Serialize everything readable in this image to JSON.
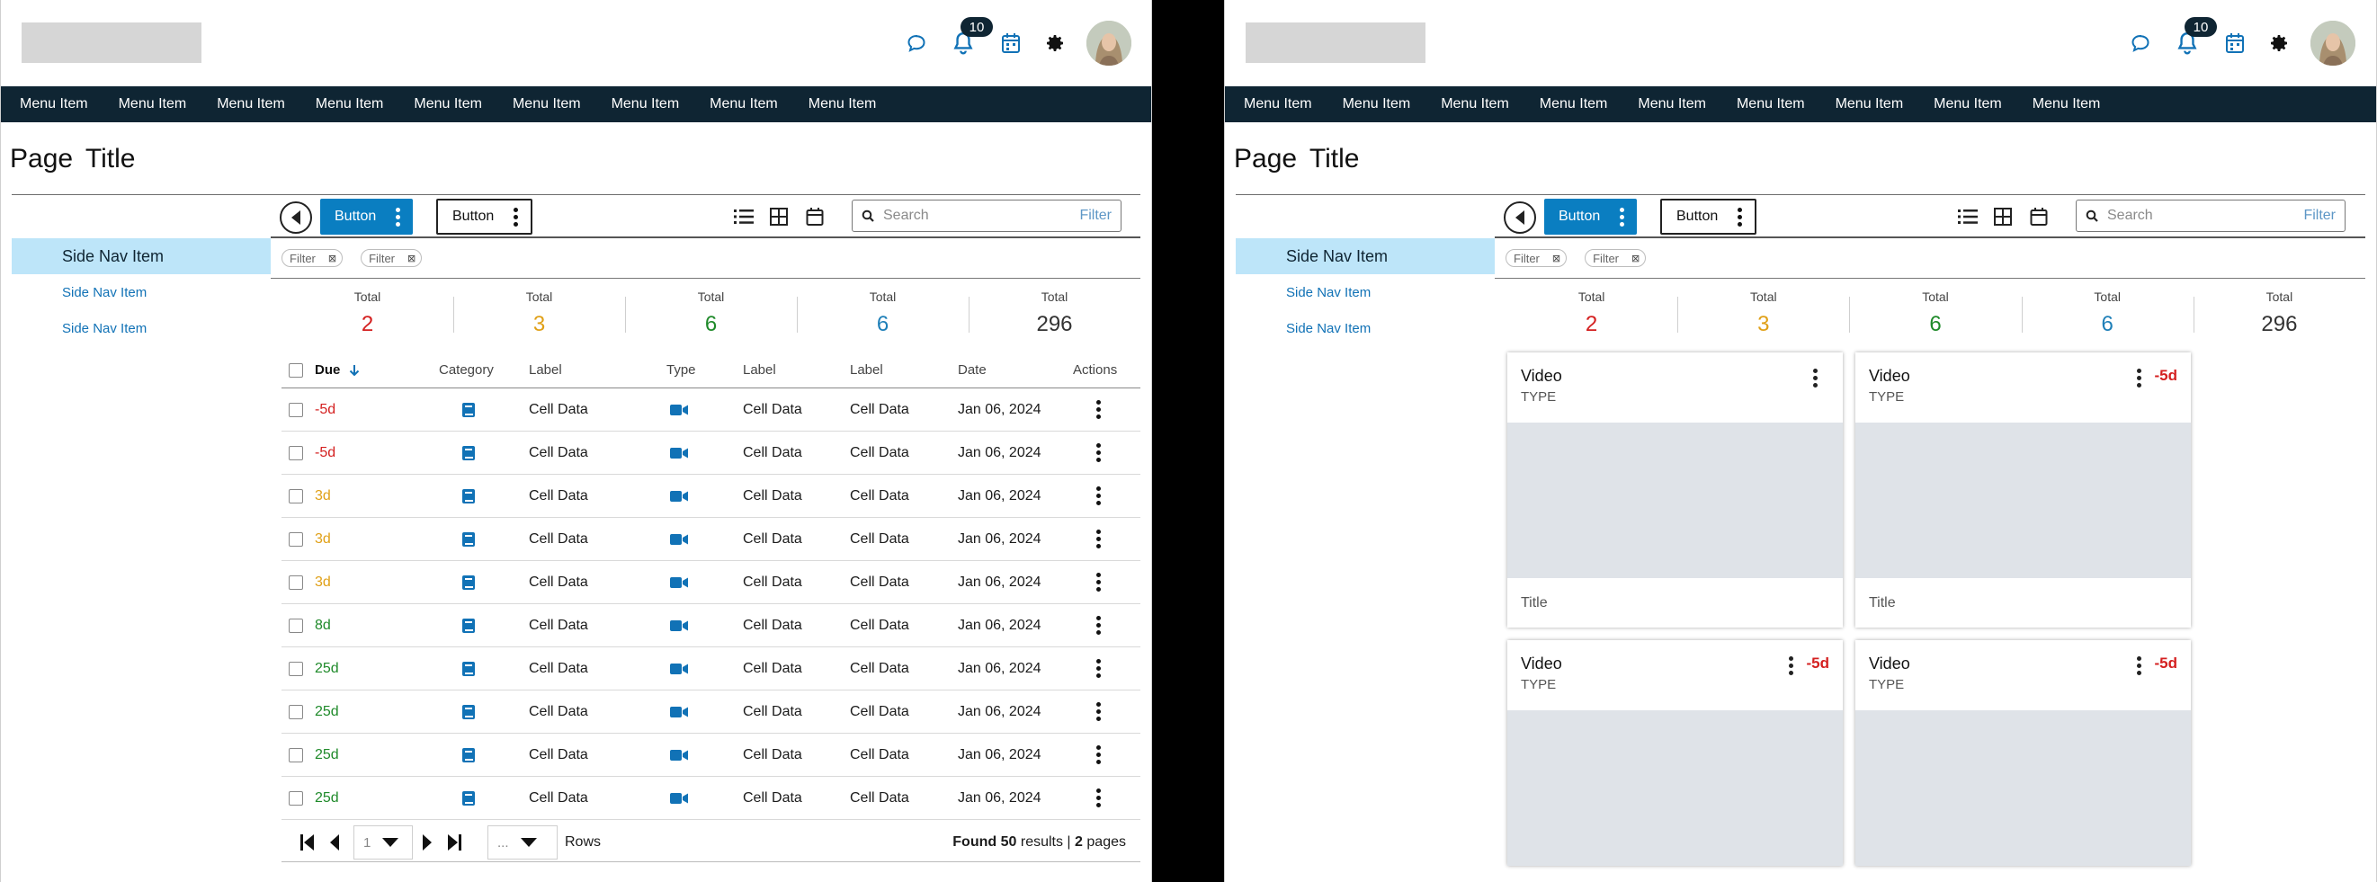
{
  "header": {
    "notification_count": "10",
    "icons": [
      "chat-icon",
      "bell-icon",
      "calendar-icon",
      "gear-icon"
    ]
  },
  "nav": {
    "items": [
      "Menu Item",
      "Menu Item",
      "Menu Item",
      "Menu Item",
      "Menu Item",
      "Menu Item",
      "Menu Item",
      "Menu Item",
      "Menu Item"
    ]
  },
  "page": {
    "title": "Page  Title"
  },
  "toolbar": {
    "button_primary": "Button",
    "button_secondary": "Button",
    "search_placeholder": "Search",
    "filter_label": "Filter"
  },
  "sidenav": {
    "items": [
      "Side Nav Item",
      "Side Nav Item",
      "Side Nav Item"
    ]
  },
  "filters": [
    "Filter",
    "Filter"
  ],
  "totals": [
    {
      "label": "Total",
      "value": "2",
      "color": "#d42020"
    },
    {
      "label": "Total",
      "value": "3",
      "color": "#e0a017"
    },
    {
      "label": "Total",
      "value": "6",
      "color": "#1f8a2a"
    },
    {
      "label": "Total",
      "value": "6",
      "color": "#1e7fb8"
    },
    {
      "label": "Total",
      "value": "296",
      "color": "#333333"
    }
  ],
  "table": {
    "columns": [
      "Due",
      "Category",
      "Label",
      "Type",
      "Label",
      "Label",
      "Date",
      "Actions"
    ],
    "rows": [
      {
        "due": "-5d",
        "status": "neg",
        "c1": "Cell Data",
        "c2": "Cell Data",
        "c3": "Cell Data",
        "date": "Jan 06, 2024"
      },
      {
        "due": "-5d",
        "status": "neg",
        "c1": "Cell Data",
        "c2": "Cell Data",
        "c3": "Cell Data",
        "date": "Jan 06, 2024"
      },
      {
        "due": "3d",
        "status": "mid",
        "c1": "Cell Data",
        "c2": "Cell Data",
        "c3": "Cell Data",
        "date": "Jan 06, 2024"
      },
      {
        "due": "3d",
        "status": "mid",
        "c1": "Cell Data",
        "c2": "Cell Data",
        "c3": "Cell Data",
        "date": "Jan 06, 2024"
      },
      {
        "due": "3d",
        "status": "mid",
        "c1": "Cell Data",
        "c2": "Cell Data",
        "c3": "Cell Data",
        "date": "Jan 06, 2024"
      },
      {
        "due": "8d",
        "status": "pos",
        "c1": "Cell Data",
        "c2": "Cell Data",
        "c3": "Cell Data",
        "date": "Jan 06, 2024"
      },
      {
        "due": "25d",
        "status": "pos",
        "c1": "Cell Data",
        "c2": "Cell Data",
        "c3": "Cell Data",
        "date": "Jan 06, 2024"
      },
      {
        "due": "25d",
        "status": "pos",
        "c1": "Cell Data",
        "c2": "Cell Data",
        "c3": "Cell Data",
        "date": "Jan 06, 2024"
      },
      {
        "due": "25d",
        "status": "pos",
        "c1": "Cell Data",
        "c2": "Cell Data",
        "c3": "Cell Data",
        "date": "Jan 06, 2024"
      },
      {
        "due": "25d",
        "status": "pos",
        "c1": "Cell Data",
        "c2": "Cell Data",
        "c3": "Cell Data",
        "date": "Jan 06, 2024"
      }
    ]
  },
  "pager": {
    "page": "1",
    "rows_value": "...",
    "rows_label": "Rows",
    "found_prefix": "Found",
    "found_count": "50",
    "found_mid": "results |",
    "pages_count": "2",
    "pages_suffix": "pages"
  },
  "cards": [
    {
      "title": "Video",
      "type": "TYPE",
      "due": "",
      "footer": "Title"
    },
    {
      "title": "Video",
      "type": "TYPE",
      "due": "-5d",
      "footer": "Title"
    },
    {
      "title": "Video",
      "type": "TYPE",
      "due": "-5d",
      "footer": ""
    },
    {
      "title": "Video",
      "type": "TYPE",
      "due": "-5d",
      "footer": ""
    }
  ],
  "colors": {
    "primary": "#0a7ec1",
    "navbar": "#0f2533",
    "sidenav_active": "#bde5f9",
    "due_negative": "#d42020",
    "due_warning": "#e0a017",
    "due_positive": "#1f8a2a"
  }
}
